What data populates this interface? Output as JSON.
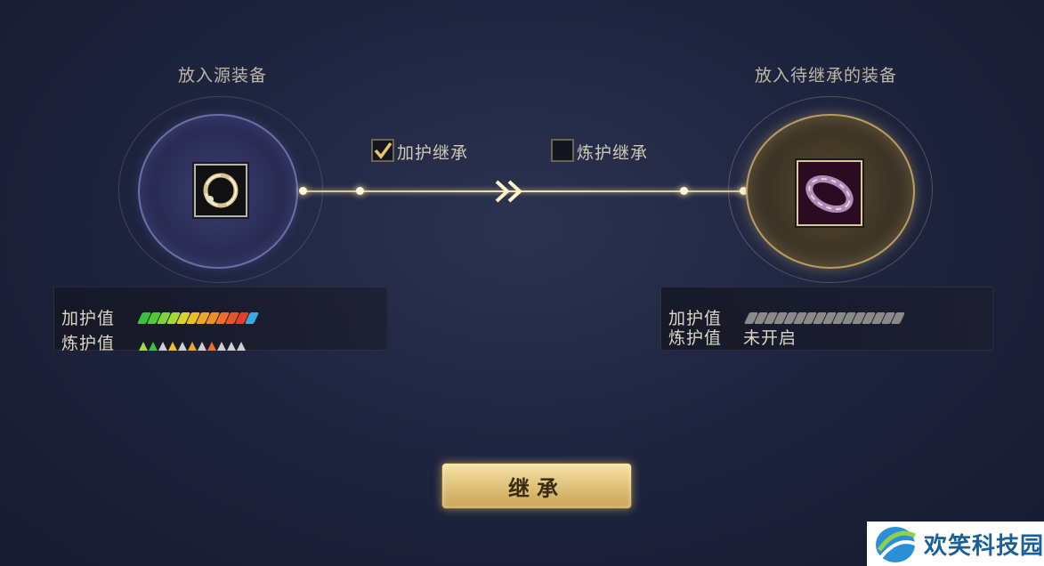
{
  "source": {
    "title": "放入源装备",
    "stats": {
      "plus_label": "加护值",
      "refine_label": "炼护值",
      "plus_bar_colors": [
        "#3fbf3f",
        "#55c83a",
        "#7fd23a",
        "#a8d835",
        "#d8d32e",
        "#e8c02a",
        "#eba52a",
        "#ee8c2a",
        "#ec6f2a",
        "#e8542a",
        "#e0402a",
        "#3ea6e0"
      ],
      "refine_tri_colors": [
        "#a6d84a",
        "#3fbf3f",
        "#cfcfcf",
        "#e8c02a",
        "#cfcfcf",
        "#e8a52a",
        "#cfcfcf",
        "#ec6f2a",
        "#cfcfcf",
        "#cfcfcf",
        "#cfcfcf"
      ]
    }
  },
  "target": {
    "title": "放入待继承的装备",
    "stats": {
      "plus_label": "加护值",
      "refine_label": "炼护值",
      "refine_value": "未开启",
      "plus_bar_count": 16,
      "plus_bar_color": "#8a8a8a"
    }
  },
  "options": {
    "inherit_plus": {
      "label": "加护继承",
      "checked": true
    },
    "inherit_refine": {
      "label": "炼护继承",
      "checked": false
    }
  },
  "action": {
    "button_label": "继承"
  },
  "watermark": {
    "text": "欢笑科技园"
  }
}
